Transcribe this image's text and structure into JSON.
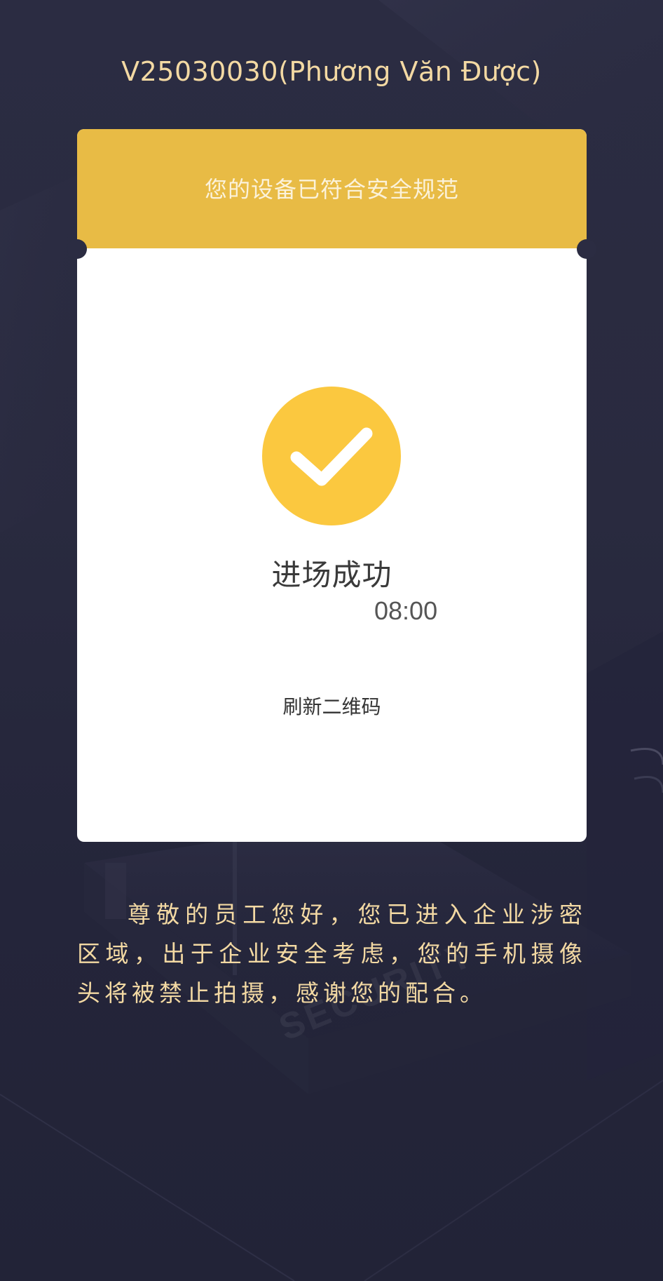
{
  "header": {
    "user_label": "V25030030(Phương Văn Được)"
  },
  "card": {
    "banner_text": "您的设备已符合安全规范",
    "status_icon": "check-circle-icon",
    "status_title": "进场成功",
    "status_time": "08:00",
    "refresh_label": "刷新二维码"
  },
  "notice": {
    "text": "尊敬的员工您好，您已进入企业涉密区域，出于企业安全考虑，您的手机摄像头将被禁止拍摄，感谢您的配合。"
  },
  "background": {
    "watermark_text": "SECURITY"
  },
  "colors": {
    "background": "#2b2c42",
    "accent_yellow": "#e8bb45",
    "check_yellow": "#fbc83f",
    "text_gold": "#f3d9a3"
  }
}
